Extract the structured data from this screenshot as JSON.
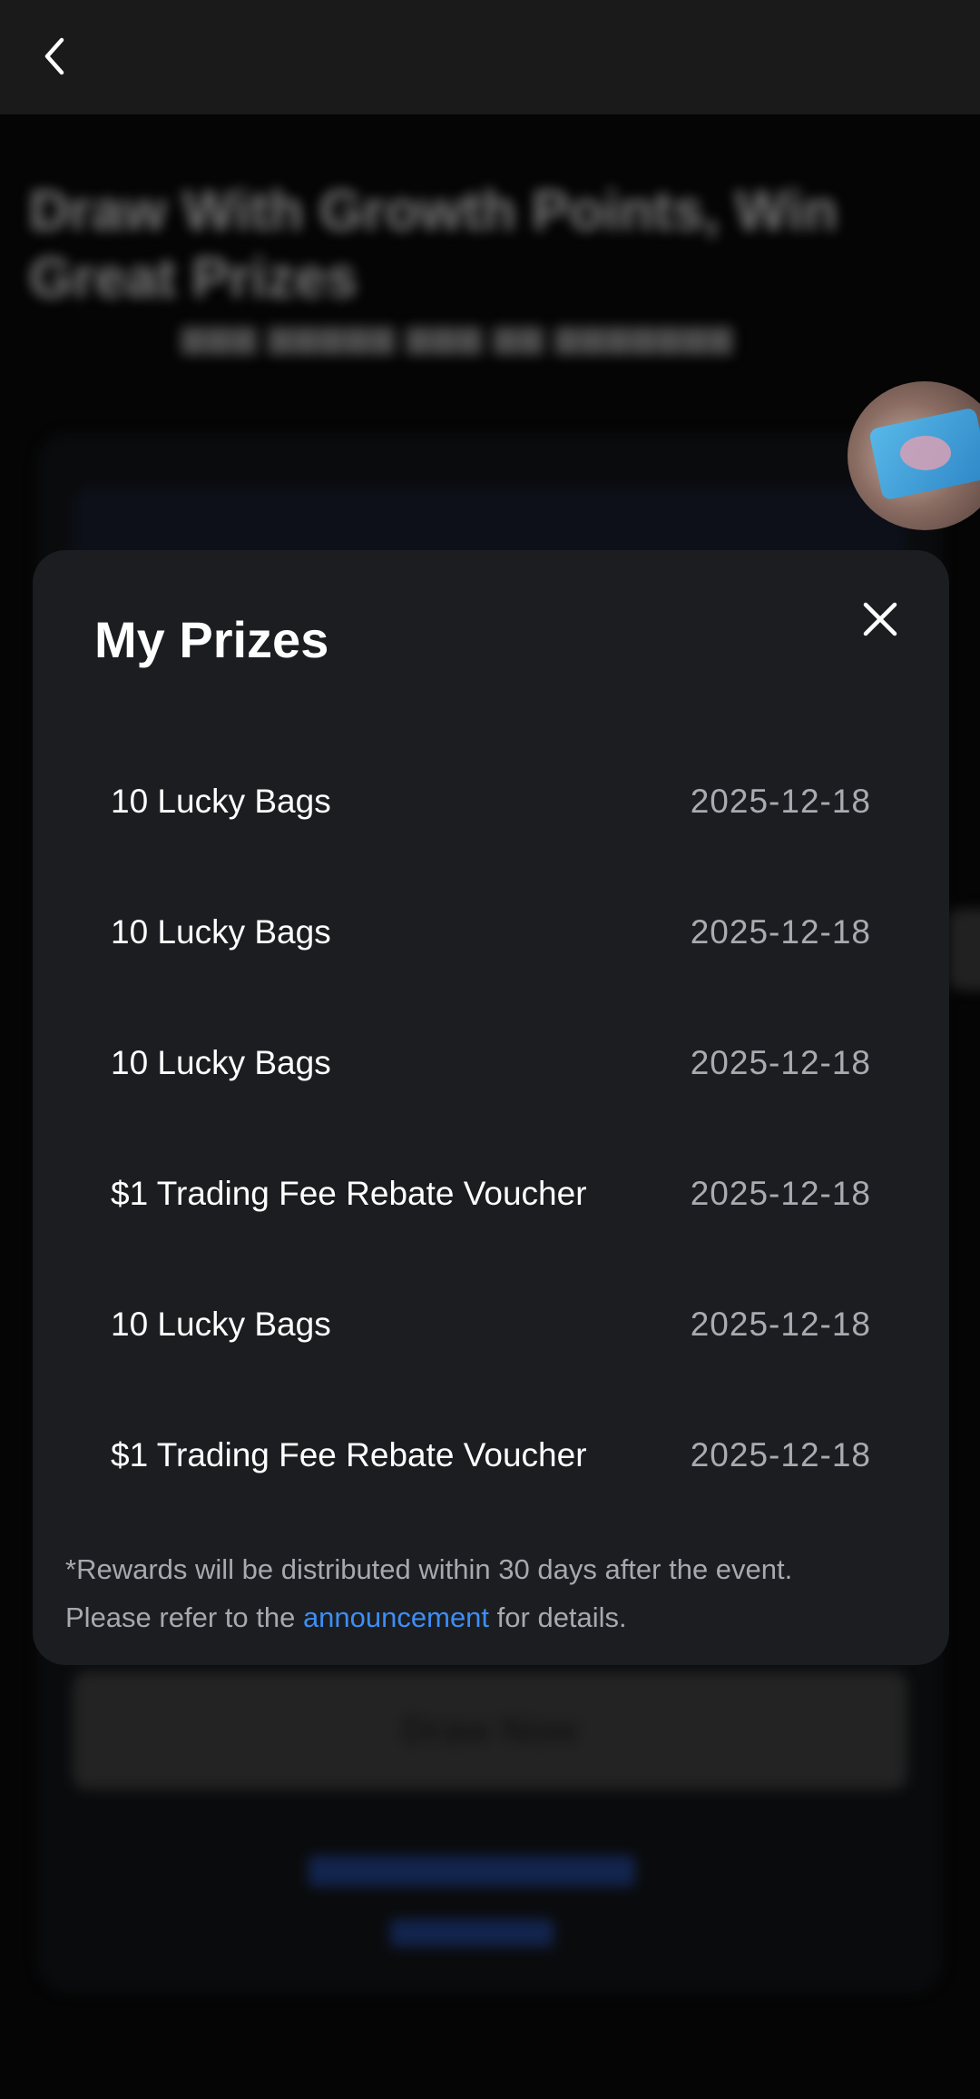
{
  "background": {
    "title": "Draw With Growth Points, Win Great Prizes",
    "draw_button": "Draw Now"
  },
  "modal": {
    "title": "My Prizes",
    "prizes": [
      {
        "name": "10 Lucky Bags",
        "date": "2025-12-18"
      },
      {
        "name": "10 Lucky Bags",
        "date": "2025-12-18"
      },
      {
        "name": "10 Lucky Bags",
        "date": "2025-12-18"
      },
      {
        "name": "$1 Trading Fee Rebate Voucher",
        "date": "2025-12-18"
      },
      {
        "name": "10 Lucky Bags",
        "date": "2025-12-18"
      },
      {
        "name": "$1 Trading Fee Rebate Voucher",
        "date": "2025-12-18"
      }
    ],
    "note_line1": "*Rewards will be distributed within 30 days after the event.",
    "note_pre": "Please refer to the ",
    "note_link": "announcement",
    "note_post": " for details."
  },
  "icons": {
    "back": "chevron-left-icon",
    "close": "close-icon"
  },
  "colors": {
    "modal_bg": "#1b1d20",
    "link": "#3e8ef5",
    "date_text": "#a8abb0"
  }
}
